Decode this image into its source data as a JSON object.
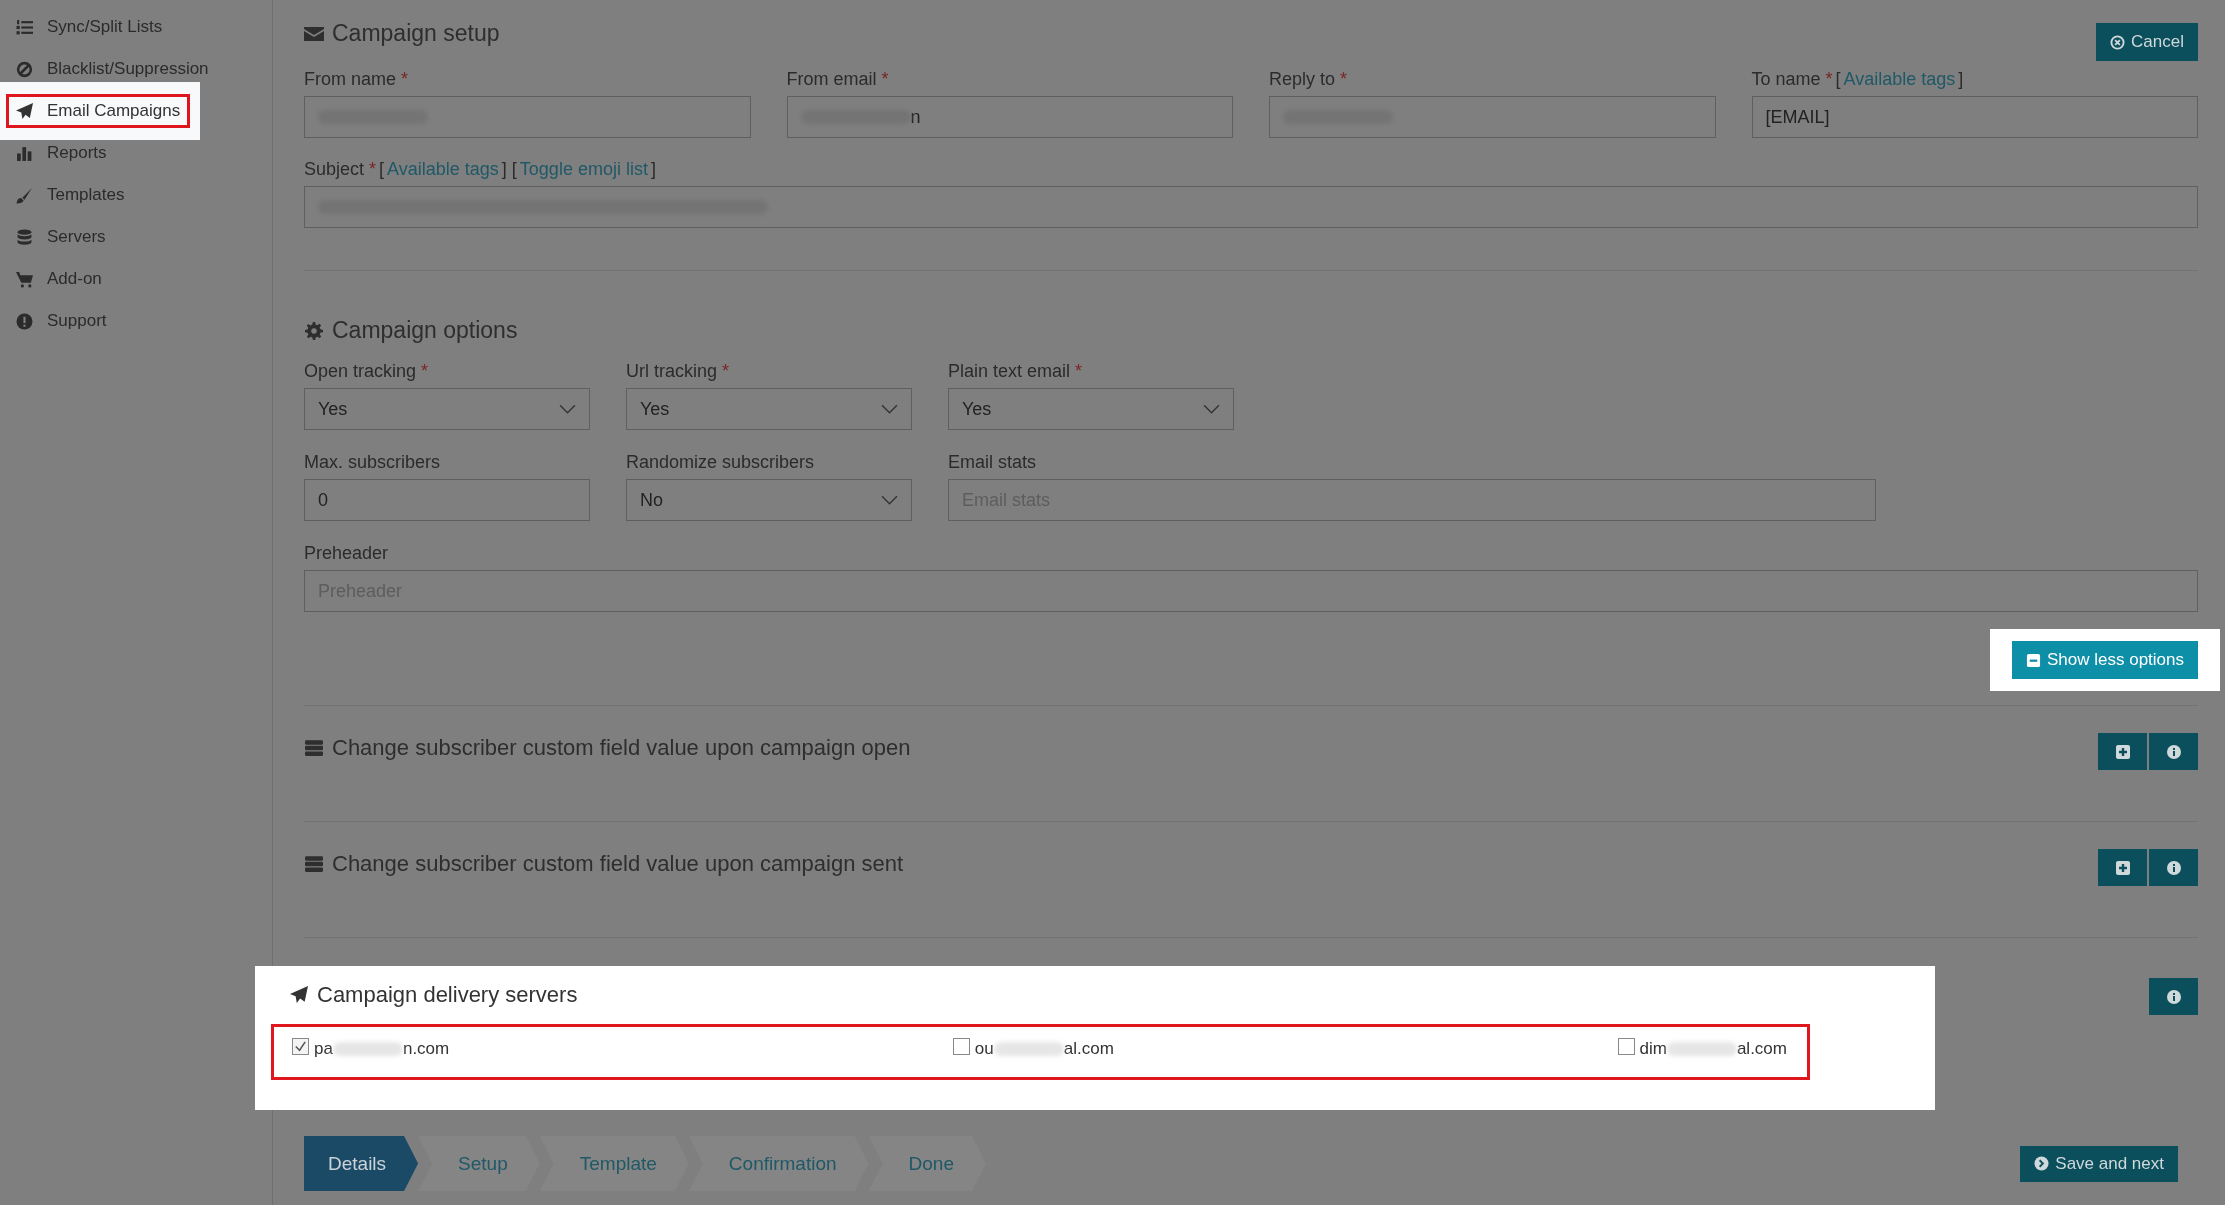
{
  "sidebar": {
    "items": [
      {
        "kind": "lists",
        "label": "Sync/Split Lists",
        "selected": false
      },
      {
        "kind": "block",
        "label": "Blacklist/Suppression",
        "selected": false
      },
      {
        "kind": "send",
        "label": "Email Campaigns",
        "selected": true
      },
      {
        "kind": "chart",
        "label": "Reports",
        "selected": false
      },
      {
        "kind": "brush",
        "label": "Templates",
        "selected": false
      },
      {
        "kind": "database",
        "label": "Servers",
        "selected": false
      },
      {
        "kind": "cart",
        "label": "Add-on",
        "selected": false
      },
      {
        "kind": "alert",
        "label": "Support",
        "selected": false
      }
    ]
  },
  "campaign_setup": {
    "title": "Campaign setup",
    "cancel_button": "Cancel",
    "fields": [
      {
        "label": "From name",
        "required": "*",
        "redacted": true
      },
      {
        "label": "From email",
        "required": "*",
        "redacted": true,
        "tail": "n"
      },
      {
        "label": "Reply to",
        "required": "*",
        "redacted": true
      },
      {
        "label": "To name",
        "required": "*",
        "links": [
          {
            "text": "[",
            "link": false
          },
          {
            "text": "Available tags",
            "link": true
          },
          {
            "text": "]",
            "link": false
          }
        ],
        "value": "[EMAIL]"
      }
    ],
    "subject": {
      "label": "Subject",
      "required": "*",
      "links": [
        {
          "text": "[",
          "link": false
        },
        {
          "text": "Available tags",
          "link": true
        },
        {
          "text": "] [",
          "link": false
        },
        {
          "text": "Toggle emoji list",
          "link": true
        },
        {
          "text": "]",
          "link": false
        }
      ],
      "redacted": true
    }
  },
  "campaign_options": {
    "title": "Campaign options",
    "row_1": [
      {
        "kind": "select",
        "label": "Open tracking",
        "required": "*",
        "value": "Yes"
      },
      {
        "kind": "select",
        "label": "Url tracking",
        "required": "*",
        "value": "Yes"
      },
      {
        "kind": "select",
        "label": "Plain text email",
        "required": "*",
        "value": "Yes"
      }
    ],
    "row_2": [
      {
        "kind": "input",
        "label": "Max. subscribers",
        "value": "0"
      },
      {
        "kind": "select",
        "label": "Randomize subscribers",
        "value": "No"
      },
      {
        "kind": "input",
        "label": "Email stats",
        "placeholder": "Email stats",
        "wide": true
      }
    ],
    "preheader": {
      "label": "Preheader",
      "placeholder": "Preheader"
    },
    "toggle_button": "Show less options",
    "toggle_highlighted": true
  },
  "custom_field_sections": [
    {
      "title": "Change subscriber custom field value upon campaign open"
    },
    {
      "title": "Change subscriber custom field value upon campaign sent"
    }
  ],
  "delivery_servers": {
    "title": "Campaign delivery servers",
    "highlighted": true,
    "servers": [
      {
        "prefix": "pa",
        "suffix": "n.com",
        "checked": true
      },
      {
        "prefix": "ou",
        "suffix": "al.com",
        "checked": false
      },
      {
        "prefix": "dim",
        "suffix": "al.com",
        "checked": false
      }
    ]
  },
  "wizard_steps": [
    {
      "label": "Details",
      "selected": true
    },
    {
      "label": "Setup",
      "selected": false
    },
    {
      "label": "Template",
      "selected": false
    },
    {
      "label": "Confirmation",
      "selected": false
    },
    {
      "label": "Done",
      "selected": false
    }
  ],
  "save_button": "Save and next"
}
